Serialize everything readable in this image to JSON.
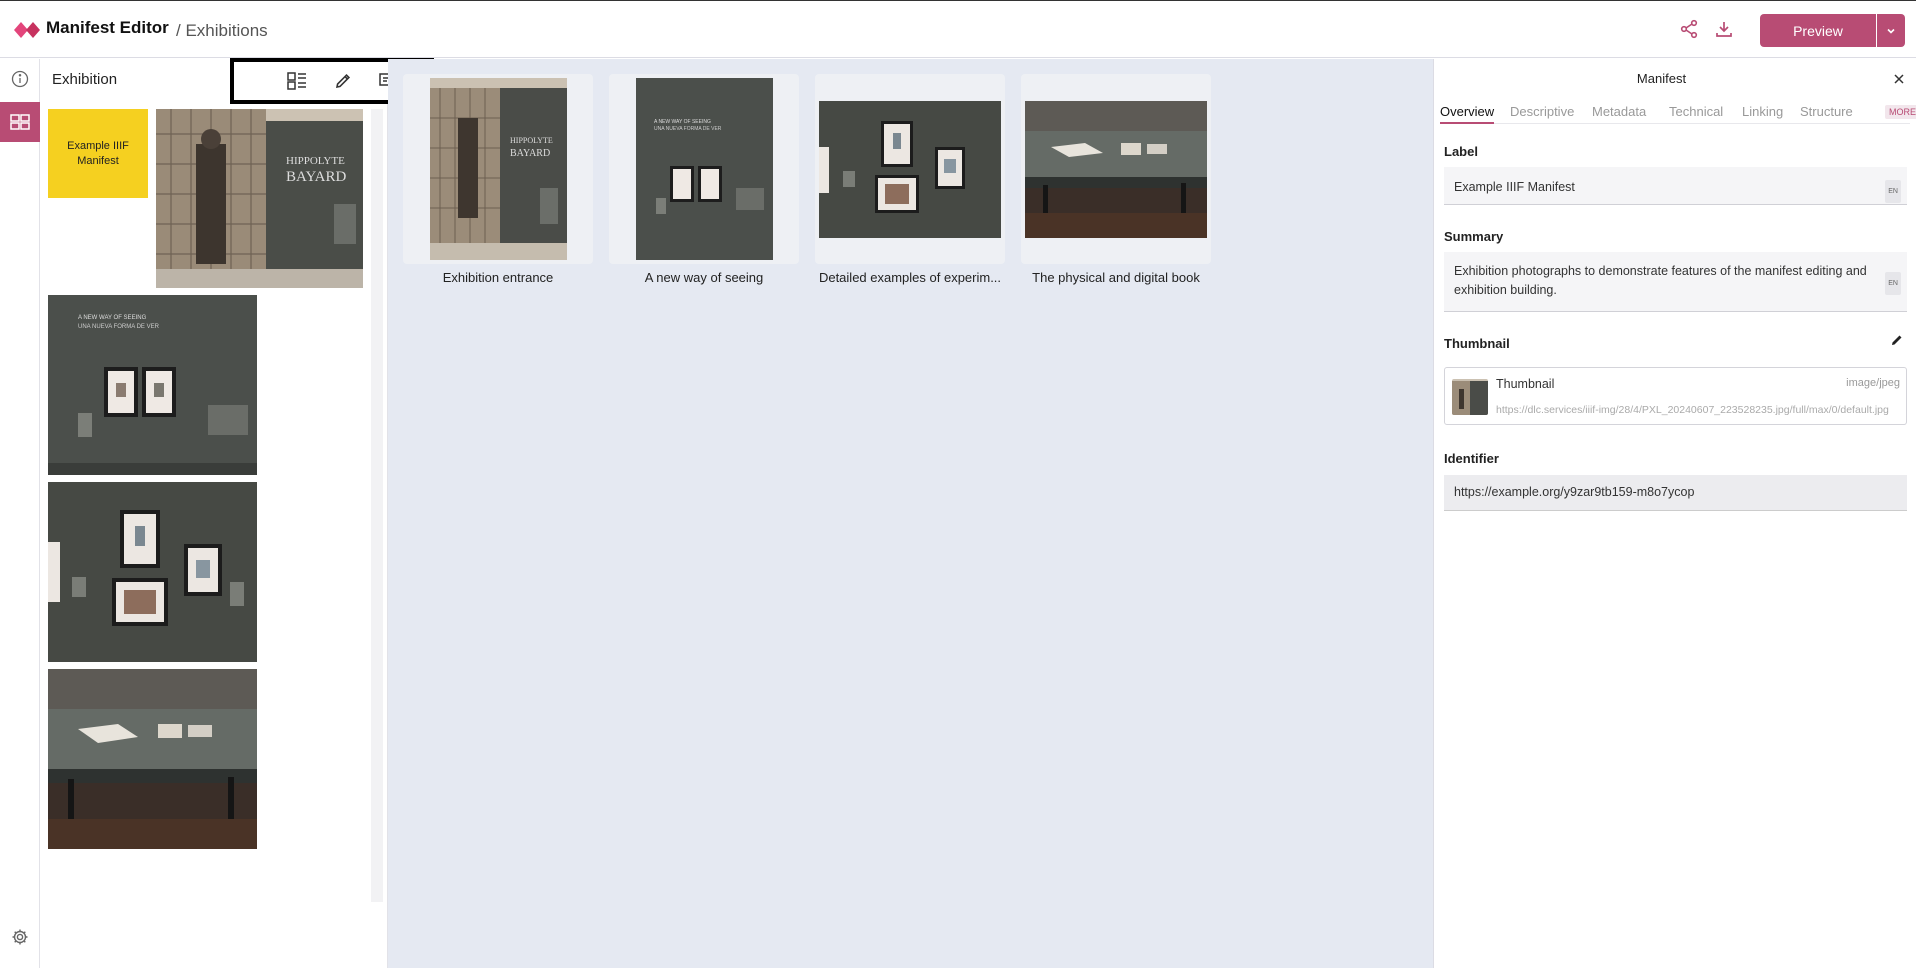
{
  "header": {
    "app_title": "Manifest Editor",
    "breadcrumb": "/ Exhibitions",
    "preview_label": "Preview",
    "brand_color": "#b84c74"
  },
  "rail": {
    "items": [
      {
        "icon": "info-icon"
      },
      {
        "icon": "grid-icon",
        "active": true
      },
      {
        "icon": "gear-icon"
      }
    ]
  },
  "left_panel": {
    "title": "Exhibition",
    "toolbar": [
      {
        "icon": "grid-layout-icon"
      },
      {
        "icon": "pencil-icon"
      },
      {
        "icon": "add-slide-icon"
      }
    ],
    "manifest_tile": "Example IIIF Manifest"
  },
  "canvas": {
    "cards": [
      {
        "label": "Exhibition entrance"
      },
      {
        "label": "A new way of seeing"
      },
      {
        "label": "Detailed examples of experim..."
      },
      {
        "label": "The physical and digital book"
      }
    ]
  },
  "right_panel": {
    "title": "Manifest",
    "tabs": [
      "Overview",
      "Descriptive",
      "Metadata",
      "Technical",
      "Linking",
      "Structure"
    ],
    "more": "MORE",
    "label_heading": "Label",
    "label_value": "Example IIIF Manifest",
    "lang": "EN",
    "summary_heading": "Summary",
    "summary_value": "Exhibition photographs to demonstrate features of the manifest editing and exhibition building.",
    "thumbnail_heading": "Thumbnail",
    "thumbnail": {
      "title": "Thumbnail",
      "type": "image/jpeg",
      "url": "https://dlc.services/iiif-img/28/4/PXL_20240607_223528235.jpg/full/max/0/default.jpg"
    },
    "identifier_heading": "Identifier",
    "identifier_value": "https://example.org/y9zar9tb159-m8o7ycop"
  }
}
